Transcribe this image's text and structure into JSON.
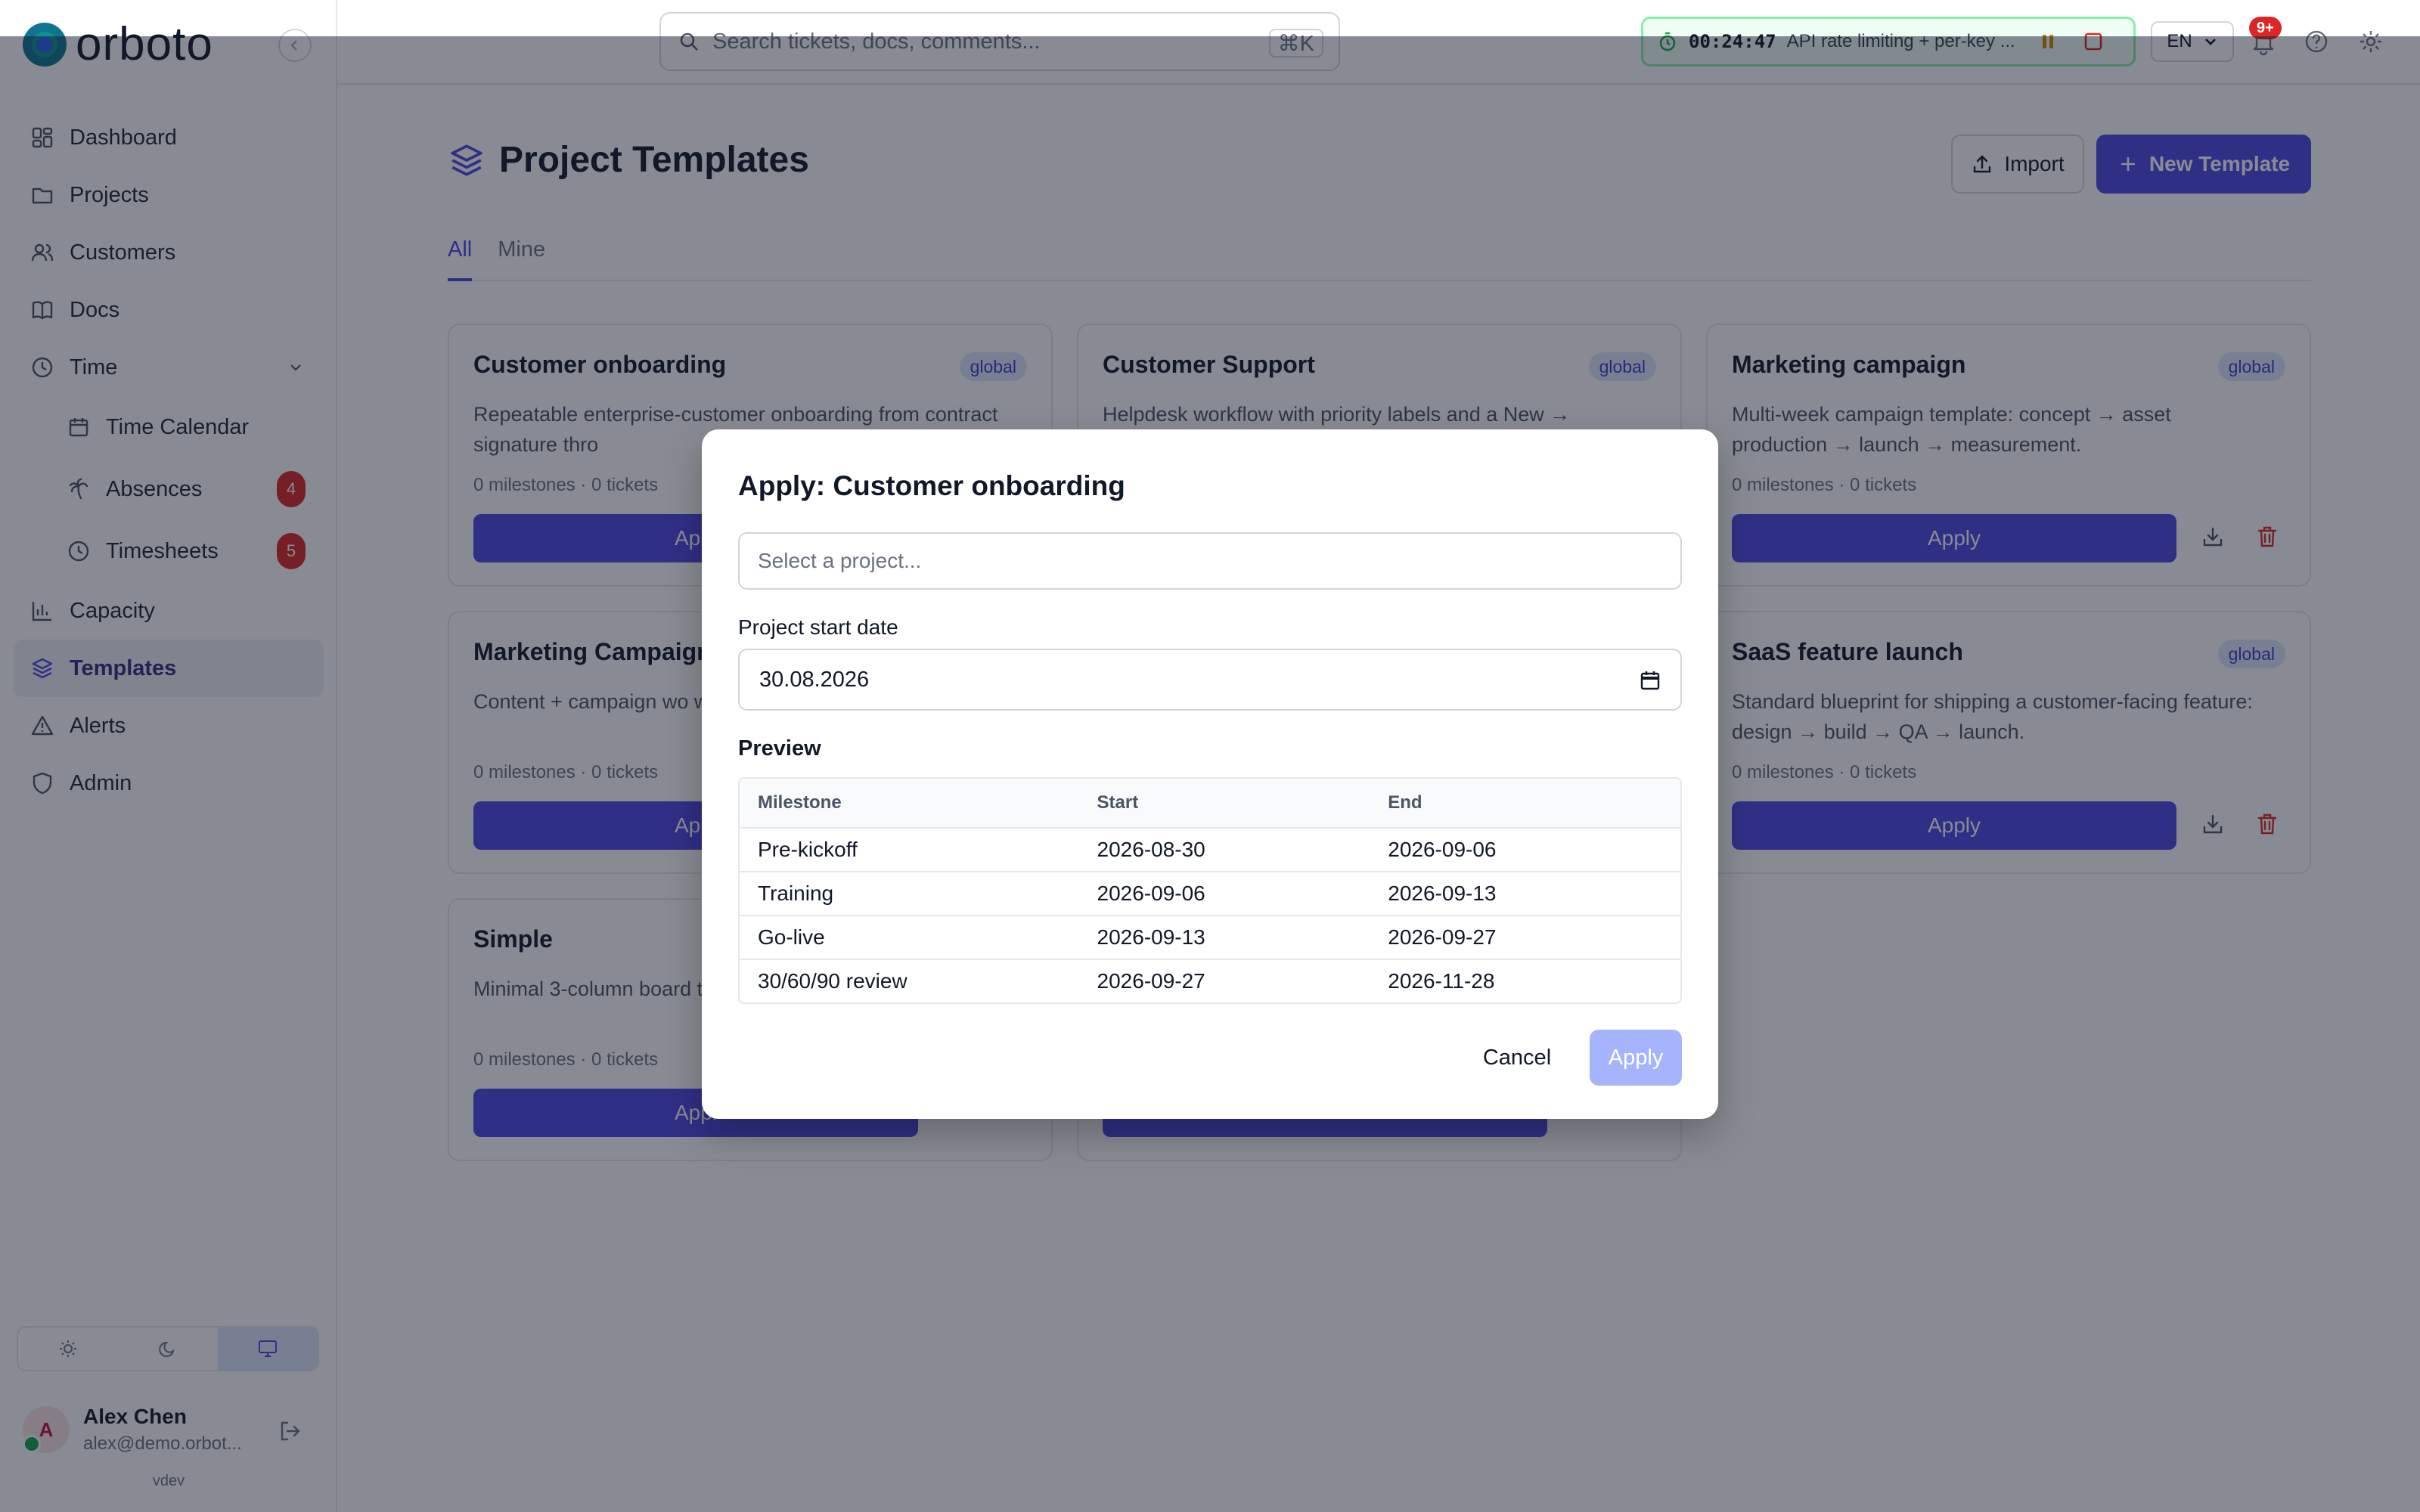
{
  "app": {
    "logo_text": "orboto",
    "version": "vdev"
  },
  "search": {
    "placeholder": "Search tickets, docs, comments...",
    "shortcut": "⌘K"
  },
  "timer": {
    "time": "00:24:47",
    "task": "API rate limiting + per-key ..."
  },
  "language": {
    "selected": "EN"
  },
  "notifications": {
    "badge": "9+"
  },
  "sidebar": {
    "items": [
      {
        "label": "Dashboard",
        "icon": "dashboard-icon"
      },
      {
        "label": "Projects",
        "icon": "folder-icon"
      },
      {
        "label": "Customers",
        "icon": "users-icon"
      },
      {
        "label": "Docs",
        "icon": "book-icon"
      },
      {
        "label": "Time",
        "icon": "clock-icon",
        "expanded": true
      },
      {
        "label": "Time Calendar",
        "icon": "calendar-icon"
      },
      {
        "label": "Absences",
        "icon": "palm-tree-icon",
        "badge": "4"
      },
      {
        "label": "Timesheets",
        "icon": "clock-icon",
        "badge": "5"
      },
      {
        "label": "Capacity",
        "icon": "bar-chart-icon"
      },
      {
        "label": "Templates",
        "icon": "layers-icon",
        "active": true
      },
      {
        "label": "Alerts",
        "icon": "alert-triangle-icon"
      },
      {
        "label": "Admin",
        "icon": "shield-icon"
      }
    ]
  },
  "user": {
    "initial": "A",
    "name": "Alex Chen",
    "email": "alex@demo.orbot..."
  },
  "page": {
    "title": "Project Templates",
    "import_label": "Import",
    "new_label": "New Template",
    "tabs": [
      {
        "label": "All",
        "active": true
      },
      {
        "label": "Mine",
        "active": false
      }
    ]
  },
  "cards": [
    {
      "title": "Customer onboarding",
      "badge": "global",
      "desc": "Repeatable enterprise-customer onboarding from contract signature thro",
      "meta": "0 milestones · 0 tickets",
      "apply": "Appl"
    },
    {
      "title": "Customer Support",
      "badge": "global",
      "desc": "Helpdesk workflow with priority labels and a New →",
      "meta": "",
      "apply": ""
    },
    {
      "title": "Marketing campaign",
      "badge": "global",
      "desc": "Multi-week campaign template: concept → asset production → launch → measurement.",
      "meta": "0 milestones · 0 tickets",
      "apply": "Apply"
    },
    {
      "title": "Marketing Campaign",
      "badge": "",
      "desc": "Content + campaign wo with monthly milestones",
      "meta": "0 milestones · 0 tickets",
      "apply": "Appl"
    },
    {
      "title": "SaaS feature launch",
      "badge": "global",
      "desc": "Standard blueprint for shipping a customer-facing feature: design → build → QA → launch.",
      "meta": "0 milestones · 0 tickets",
      "apply": "Apply"
    },
    {
      "title": "Simple",
      "badge": "",
      "desc": "Minimal 3-column board teams who want To Do,",
      "meta": "0 milestones · 0 tickets",
      "apply": "Appl"
    },
    {
      "title": "",
      "badge": "",
      "desc": "",
      "meta": "",
      "apply": ""
    }
  ],
  "modal": {
    "title": "Apply: Customer onboarding",
    "project_placeholder": "Select a project...",
    "date_label": "Project start date",
    "date_value": "30.08.2026",
    "preview_label": "Preview",
    "columns": [
      "Milestone",
      "Start",
      "End"
    ],
    "rows": [
      {
        "milestone": "Pre-kickoff",
        "start": "2026-08-30",
        "end": "2026-09-06"
      },
      {
        "milestone": "Training",
        "start": "2026-09-06",
        "end": "2026-09-13"
      },
      {
        "milestone": "Go-live",
        "start": "2026-09-13",
        "end": "2026-09-27"
      },
      {
        "milestone": "30/60/90 review",
        "start": "2026-09-27",
        "end": "2026-11-28"
      }
    ],
    "cancel_label": "Cancel",
    "apply_label": "Apply"
  },
  "colors": {
    "primary": "#4f46e5",
    "badge_red": "#dc2626",
    "overlay": "#111827",
    "timer_border": "#86efac"
  }
}
